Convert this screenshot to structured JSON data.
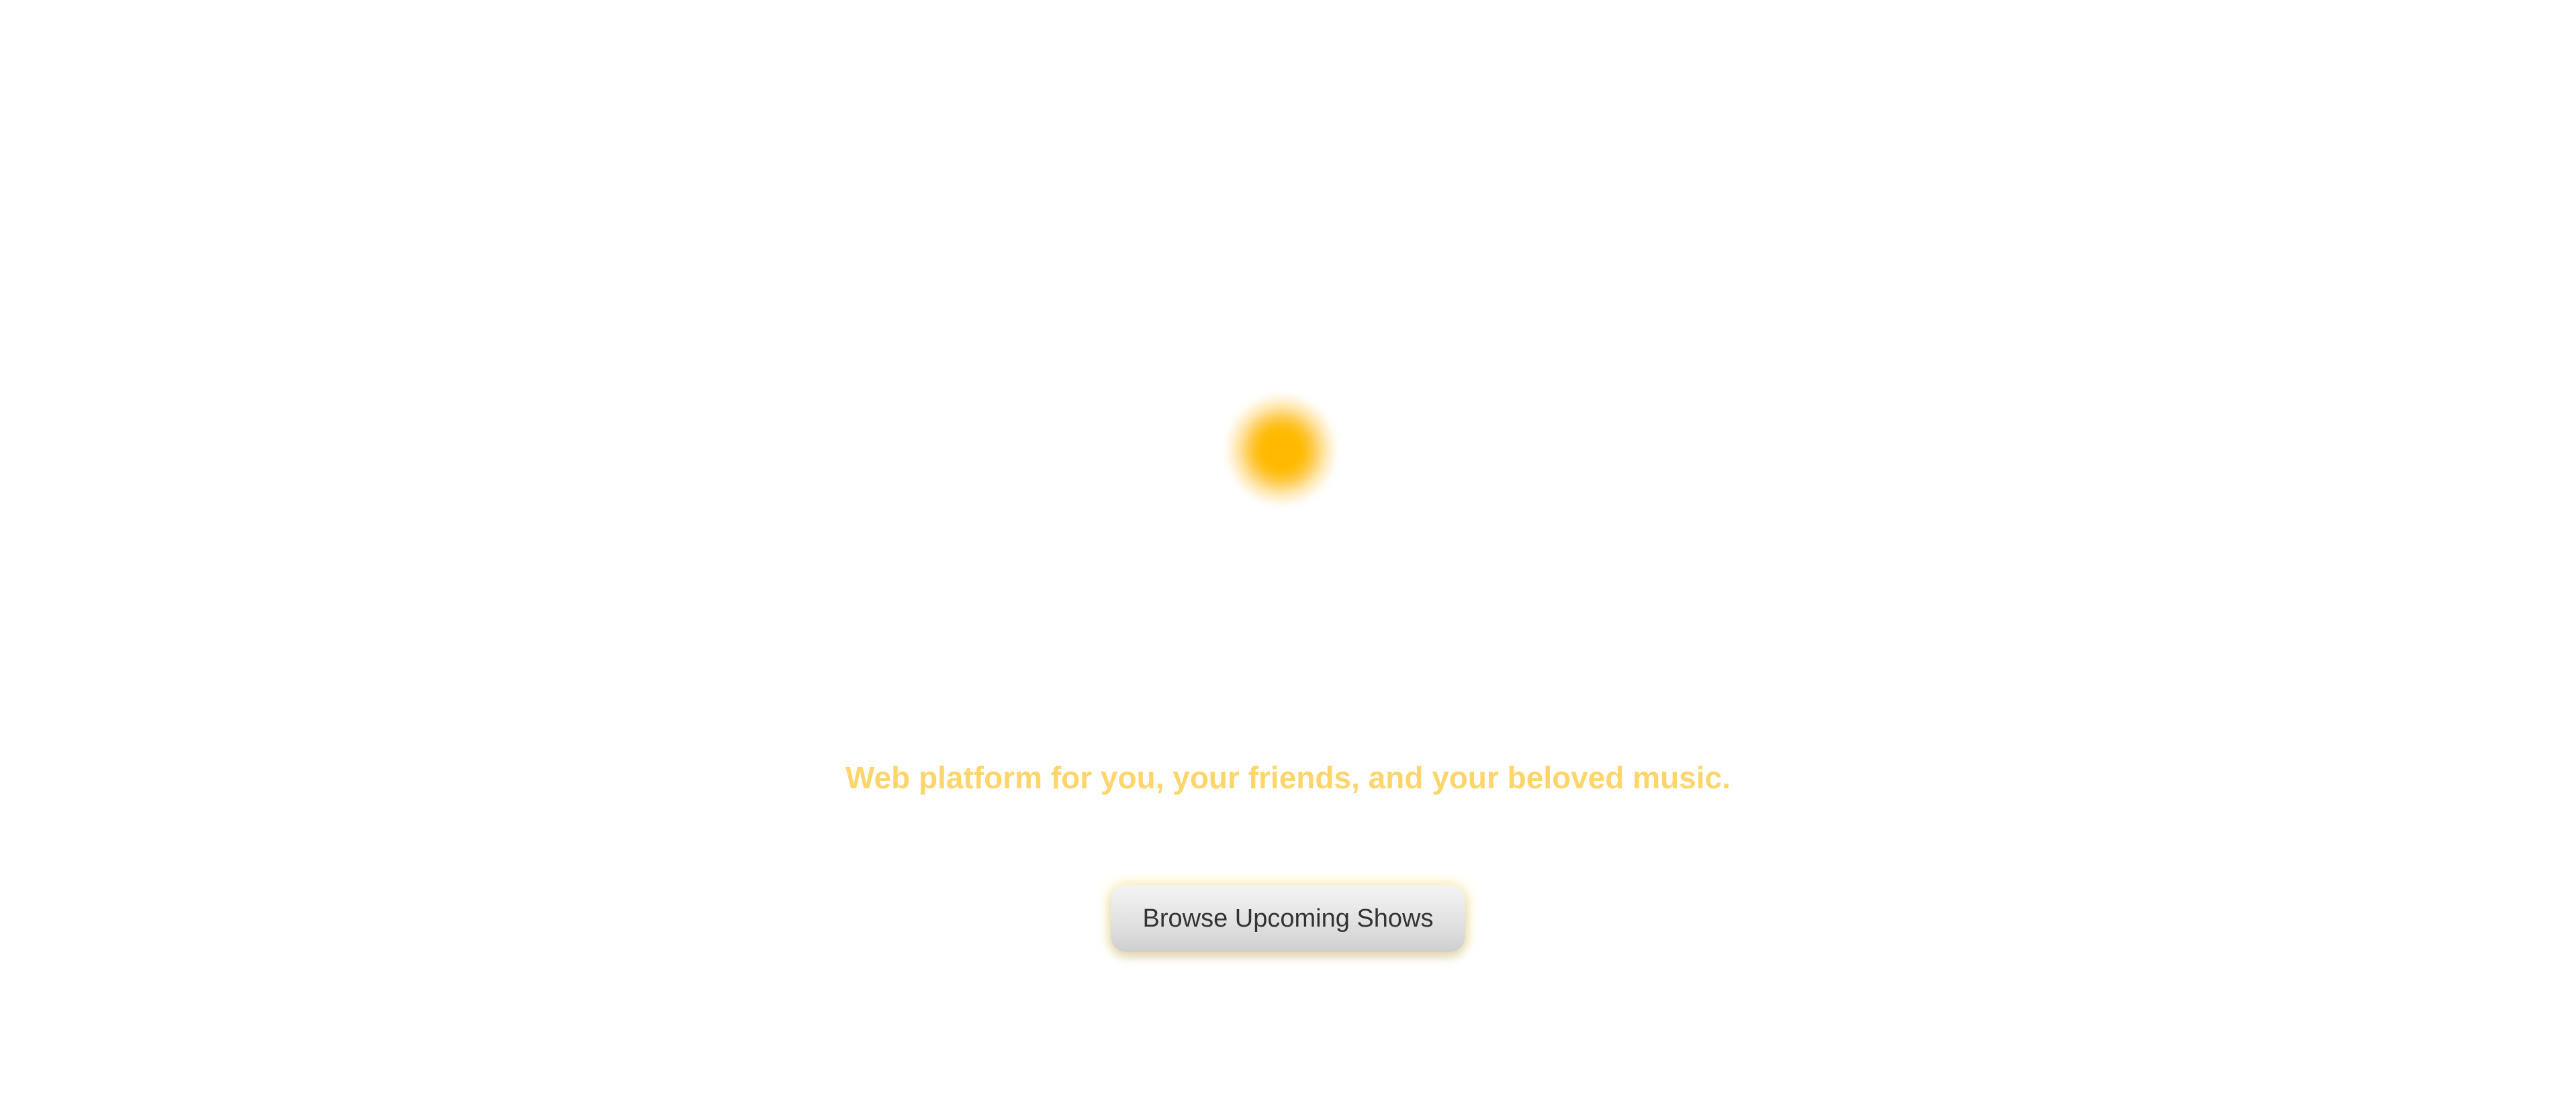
{
  "hero": {
    "logo_icon": "glowing-sun-orb-icon",
    "tagline": "Web platform for you, your friends, and your beloved music.",
    "cta_label": "Browse Upcoming Shows"
  },
  "colors": {
    "accent": "#ffbb00",
    "tagline": "#fdd56b",
    "button_text": "#333333",
    "background": "#ffffff"
  }
}
